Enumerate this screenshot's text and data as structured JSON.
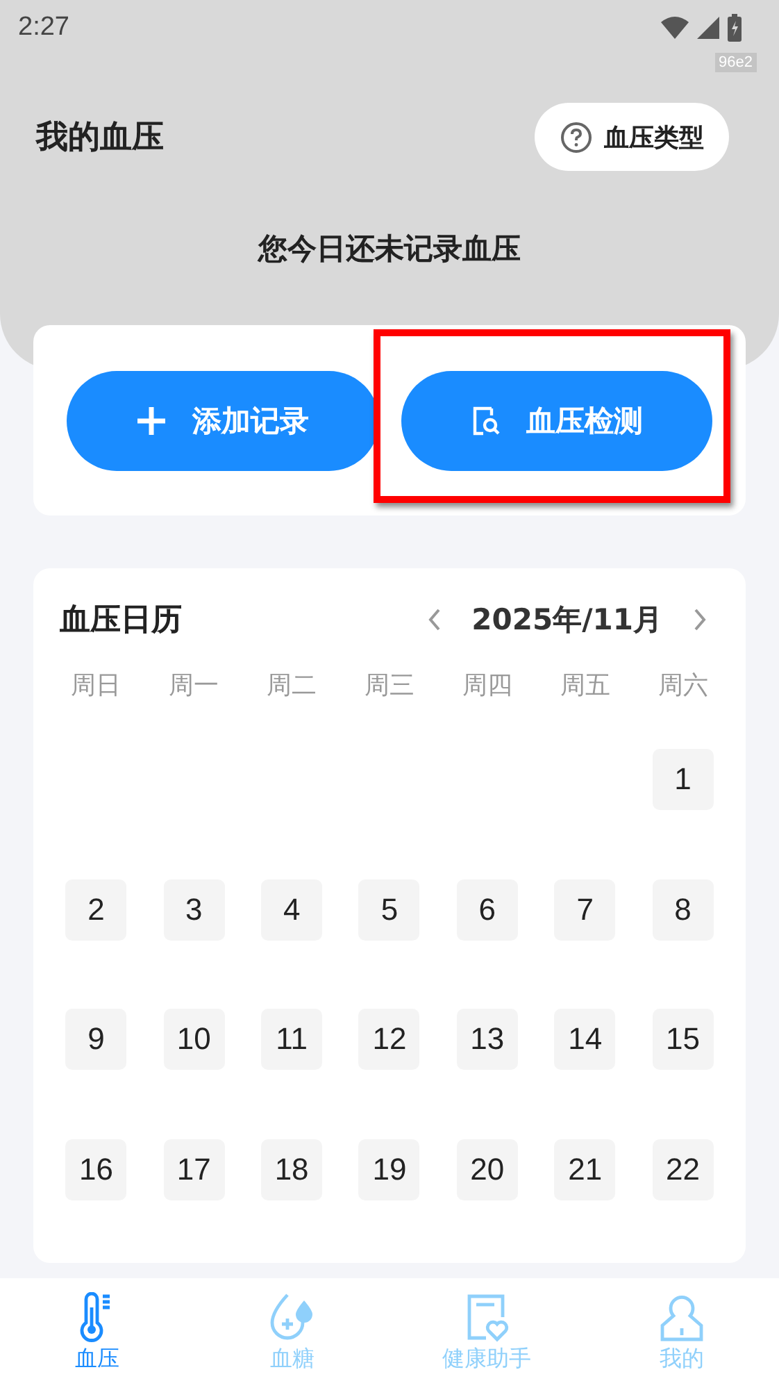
{
  "status_bar": {
    "time": "2:27",
    "badge": "96e2"
  },
  "header": {
    "title": "我的血压",
    "type_button": "血压类型",
    "notice": "您今日还未记录血压"
  },
  "action_buttons": [
    {
      "kind": "add",
      "label": "添加记录",
      "highlighted": false
    },
    {
      "kind": "detect",
      "label": "血压检测",
      "highlighted": true
    }
  ],
  "calendar": {
    "title": "血压日历",
    "month": "2025年/11月",
    "weekdays": [
      "周日",
      "周一",
      "周二",
      "周三",
      "周四",
      "周五",
      "周六"
    ],
    "weeks": [
      [
        "1"
      ],
      [
        "2",
        "3",
        "4",
        "5",
        "6",
        "7",
        "8"
      ],
      [
        "9",
        "10",
        "11",
        "12",
        "13",
        "14",
        "15"
      ],
      [
        "16",
        "17",
        "18",
        "19",
        "20",
        "21",
        "22"
      ]
    ]
  },
  "nav": [
    {
      "kind": "pressure",
      "label": "血压",
      "selected": true
    },
    {
      "kind": "sugar",
      "label": "血糖",
      "selected": false
    },
    {
      "kind": "assistant",
      "label": "健康助手",
      "selected": false
    },
    {
      "kind": "profile",
      "label": "我的",
      "selected": false
    }
  ]
}
